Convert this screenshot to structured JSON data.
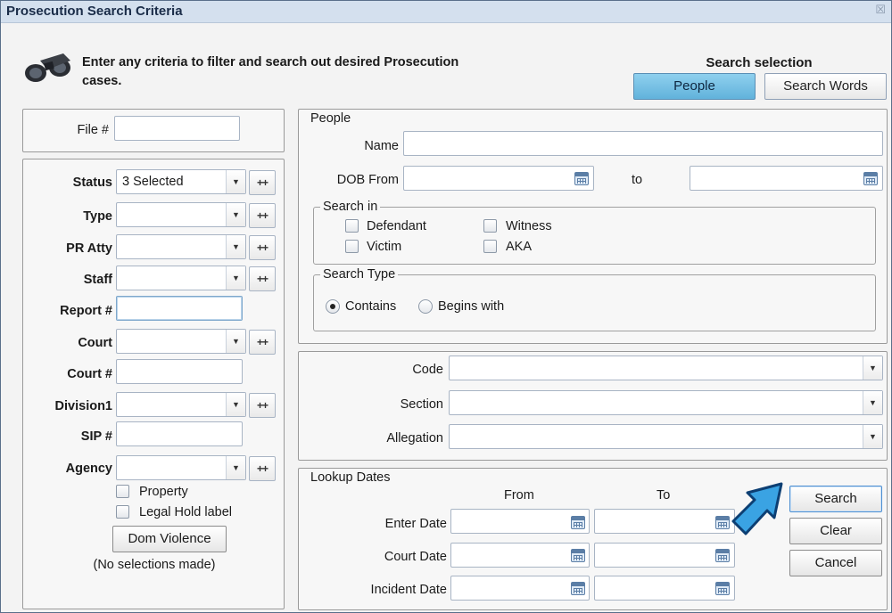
{
  "window": {
    "title": "Prosecution Search Criteria",
    "close_glyph": "☒"
  },
  "intro": {
    "icon": "binoculars-icon",
    "text": "Enter any criteria to filter and search out desired Prosecution cases."
  },
  "search_selection": {
    "title": "Search selection",
    "people_label": "People",
    "search_words_label": "Search Words",
    "active": "People"
  },
  "left": {
    "file_label": "File #",
    "file_value": "",
    "fields": {
      "status": {
        "label": "Status",
        "value": "3 Selected"
      },
      "type": {
        "label": "Type",
        "value": ""
      },
      "pr_atty": {
        "label": "PR Atty",
        "value": ""
      },
      "staff": {
        "label": "Staff",
        "value": ""
      },
      "report": {
        "label": "Report #",
        "value": ""
      },
      "court": {
        "label": "Court",
        "value": ""
      },
      "court_no": {
        "label": "Court #",
        "value": ""
      },
      "division": {
        "label": "Division1",
        "value": ""
      },
      "sip": {
        "label": "SIP #",
        "value": ""
      },
      "agency": {
        "label": "Agency",
        "value": ""
      }
    },
    "plus_label": "++",
    "property_label": "Property",
    "legal_hold_label": "Legal Hold label",
    "dom_violence_label": "Dom Violence",
    "no_selections": "(No selections made)"
  },
  "people": {
    "legend": "People",
    "name_label": "Name",
    "name_value": "",
    "dob_from_label": "DOB From",
    "dob_from_value": "",
    "to_label": "to",
    "dob_to_value": "",
    "search_in": {
      "legend": "Search in",
      "defendant": "Defendant",
      "witness": "Witness",
      "victim": "Victim",
      "aka": "AKA"
    },
    "search_type": {
      "legend": "Search Type",
      "contains": "Contains",
      "begins_with": "Begins with",
      "selected": "Contains"
    }
  },
  "codes": {
    "code_label": "Code",
    "code_value": "",
    "section_label": "Section",
    "section_value": "",
    "allegation_label": "Allegation",
    "allegation_value": ""
  },
  "lookup": {
    "legend": "Lookup Dates",
    "from_header": "From",
    "to_header": "To",
    "enter_date_label": "Enter Date",
    "court_date_label": "Court Date",
    "incident_date_label": "Incident Date"
  },
  "actions": {
    "search": "Search",
    "clear": "Clear",
    "cancel": "Cancel"
  },
  "colors": {
    "accent": "#61b2db",
    "arrow": "#3aa3e3",
    "title_bar": "#d4e0ee"
  }
}
